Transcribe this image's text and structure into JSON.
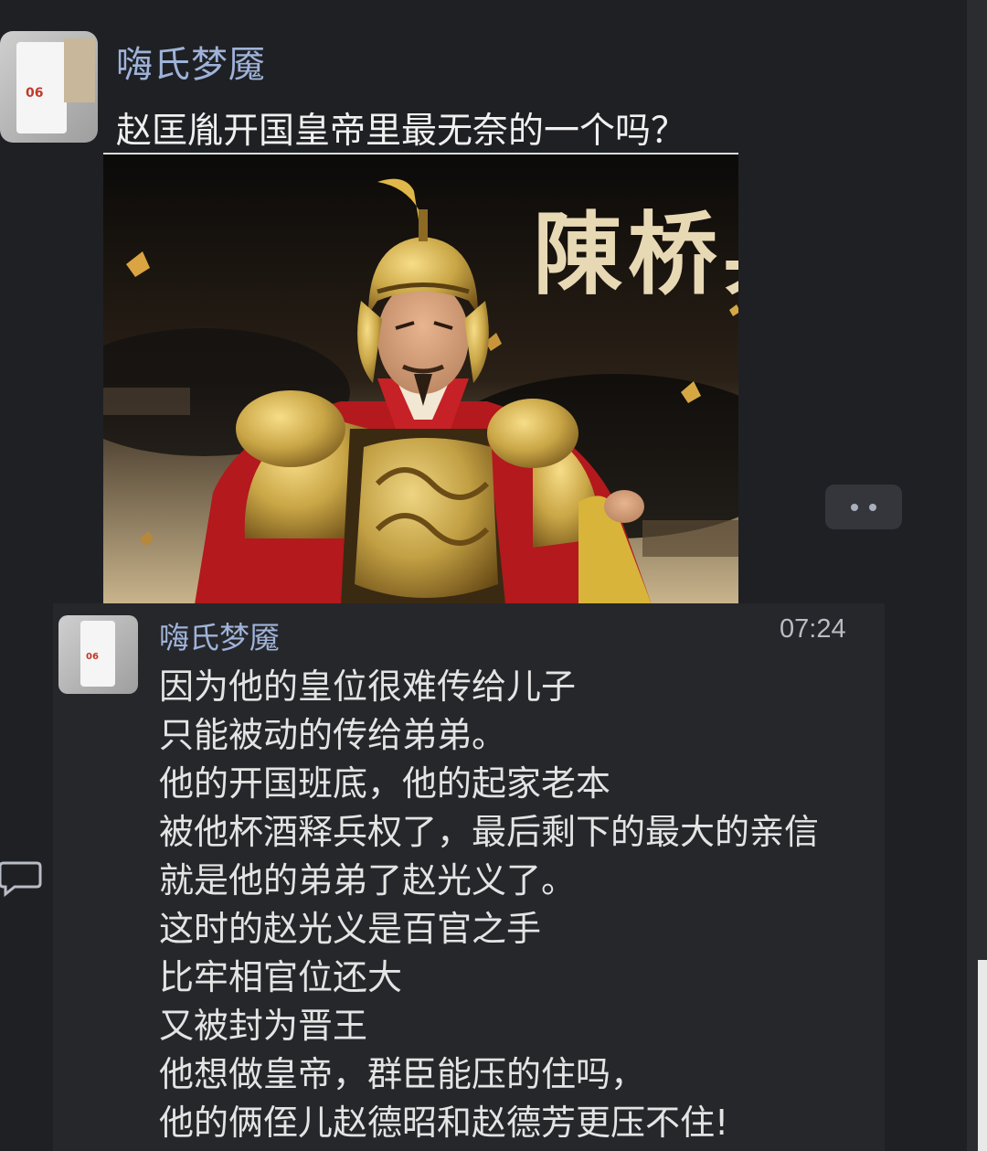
{
  "thread": {
    "author": "嗨氏梦魇",
    "question": "赵匡胤开国皇帝里最无奈的一个吗？",
    "image": {
      "title_text": "陳桥兵",
      "icon": "emperor-armor-illustration"
    }
  },
  "more_button": {
    "icon": "more-dots-icon"
  },
  "reply": {
    "author": "嗨氏梦魇",
    "time": "07:24",
    "lines": [
      "因为他的皇位很难传给儿子",
      "只能被动的传给弟弟。",
      "他的开国班底，他的起家老本",
      "被他杯酒释兵权了，最后剩下的最大的亲信",
      "就是他的弟弟了赵光义了。",
      "这时的赵光义是百官之手",
      "比牢相官位还大",
      "又被封为晋王",
      "他想做皇帝，群臣能压的住吗，",
      "他的俩侄儿赵德昭和赵德芳更压不住!"
    ]
  },
  "side": {
    "comment_icon": "comment-icon"
  },
  "colors": {
    "background": "#1f2024",
    "name": "#9fb3d9",
    "text": "#e4e4e4",
    "gold": "#c9a646",
    "red": "#b3191d"
  }
}
